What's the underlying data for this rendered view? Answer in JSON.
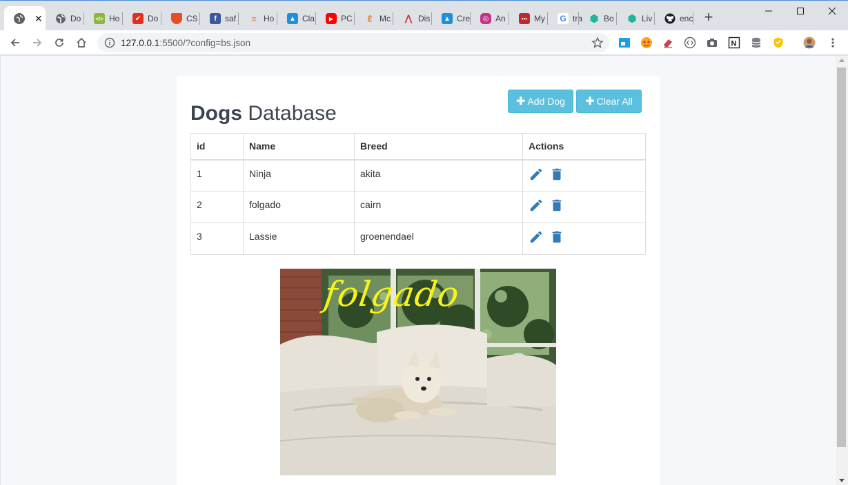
{
  "browser": {
    "tabs": [
      {
        "title": "",
        "fav_color": "#5f6368",
        "fav_glyph": ""
      },
      {
        "title": "Do",
        "fav_color": "#5f6368",
        "fav_glyph": ""
      },
      {
        "title": "Ho",
        "fav_color": "#8bb63f",
        "fav_glyph": "</>"
      },
      {
        "title": "Do",
        "fav_color": "#e0301e",
        "fav_glyph": "✔"
      },
      {
        "title": "CS",
        "fav_color": "#e44d26",
        "fav_glyph": ""
      },
      {
        "title": "saf",
        "fav_color": "#3b5998",
        "fav_glyph": "f"
      },
      {
        "title": "Ho",
        "fav_color": "#f48024",
        "fav_glyph": "≡"
      },
      {
        "title": "Cla",
        "fav_color": "#1f8fd6",
        "fav_glyph": "▲"
      },
      {
        "title": "PC",
        "fav_color": "#ff0000",
        "fav_glyph": "▶"
      },
      {
        "title": "Mc",
        "fav_color": "#f0a030",
        "fav_glyph": "ℓ"
      },
      {
        "title": "Dis",
        "fav_color": "#d0342c",
        "fav_glyph": "⋀"
      },
      {
        "title": "Cre",
        "fav_color": "#1f8fd6",
        "fav_glyph": "▲"
      },
      {
        "title": "An",
        "fav_color": "#c13584",
        "fav_glyph": "◎"
      },
      {
        "title": "My",
        "fav_color": "#c0282e",
        "fav_glyph": "•••"
      },
      {
        "title": "tra",
        "fav_color": "#ffffff",
        "fav_glyph": "G"
      },
      {
        "title": "Bo",
        "fav_color": "#22b59a",
        "fav_glyph": "⬢"
      },
      {
        "title": "Liv",
        "fav_color": "#22b59a",
        "fav_glyph": "⬢"
      },
      {
        "title": "enc",
        "fav_color": "#1b1f23",
        "fav_glyph": "●"
      }
    ],
    "new_tab": "+",
    "url_host": "127.0.0.1",
    "url_rest": ":5500/?config=bs.json"
  },
  "page": {
    "title_bold": "Dogs",
    "title_light": "Database",
    "add_button": "Add Dog",
    "clear_button": "Clear All",
    "table": {
      "headers": [
        "id",
        "Name",
        "Breed",
        "Actions"
      ],
      "rows": [
        {
          "id": "1",
          "name": "Ninja",
          "breed": "akita"
        },
        {
          "id": "2",
          "name": "folgado",
          "breed": "cairn"
        },
        {
          "id": "3",
          "name": "Lassie",
          "breed": "groenendael"
        }
      ]
    },
    "photo_caption": "folgado",
    "accent": "#5bc0de",
    "icon_color": "#337ab7"
  }
}
